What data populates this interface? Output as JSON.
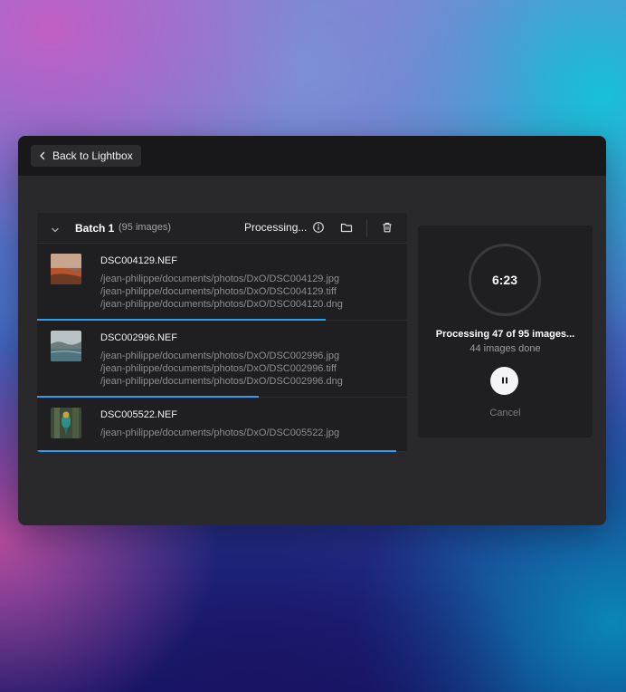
{
  "toolbar": {
    "back_label": "Back to Lightbox"
  },
  "batch": {
    "title": "Batch 1",
    "count": "(95 images)",
    "status": "Processing..."
  },
  "images": [
    {
      "name": "DSC004129.NEF",
      "paths": [
        "/jean-philippe/documents/photos/DxO/DSC004129.jpg",
        "/jean-philippe/documents/photos/DxO/DSC004129.tiff",
        "/jean-philippe/documents/photos/DxO/DSC004120.dng"
      ],
      "progress": 0.78
    },
    {
      "name": "DSC002996.NEF",
      "paths": [
        "/jean-philippe/documents/photos/DxO/DSC002996.jpg",
        "/jean-philippe/documents/photos/DxO/DSC002996.tiff",
        "/jean-philippe/documents/photos/DxO/DSC002996.dng"
      ],
      "progress": 0.6
    },
    {
      "name": "DSC005522.NEF",
      "paths": [
        "/jean-philippe/documents/photos/DxO/DSC005522.jpg"
      ],
      "progress": 0.97
    }
  ],
  "processing": {
    "timer": "6:23",
    "title": "Processing 47 of 95 images...",
    "done": "44 images done",
    "cancel_label": "Cancel"
  },
  "colors": {
    "accent": "#2a9df4",
    "window_bg": "#29292c",
    "panel_bg": "#1f1f22",
    "titlebar_bg": "#18181a"
  },
  "icons": {
    "back": "chevron-left-icon",
    "collapse": "chevron-down-icon",
    "info": "info-icon",
    "folder": "folder-icon",
    "delete": "trash-icon",
    "pause": "pause-icon"
  }
}
